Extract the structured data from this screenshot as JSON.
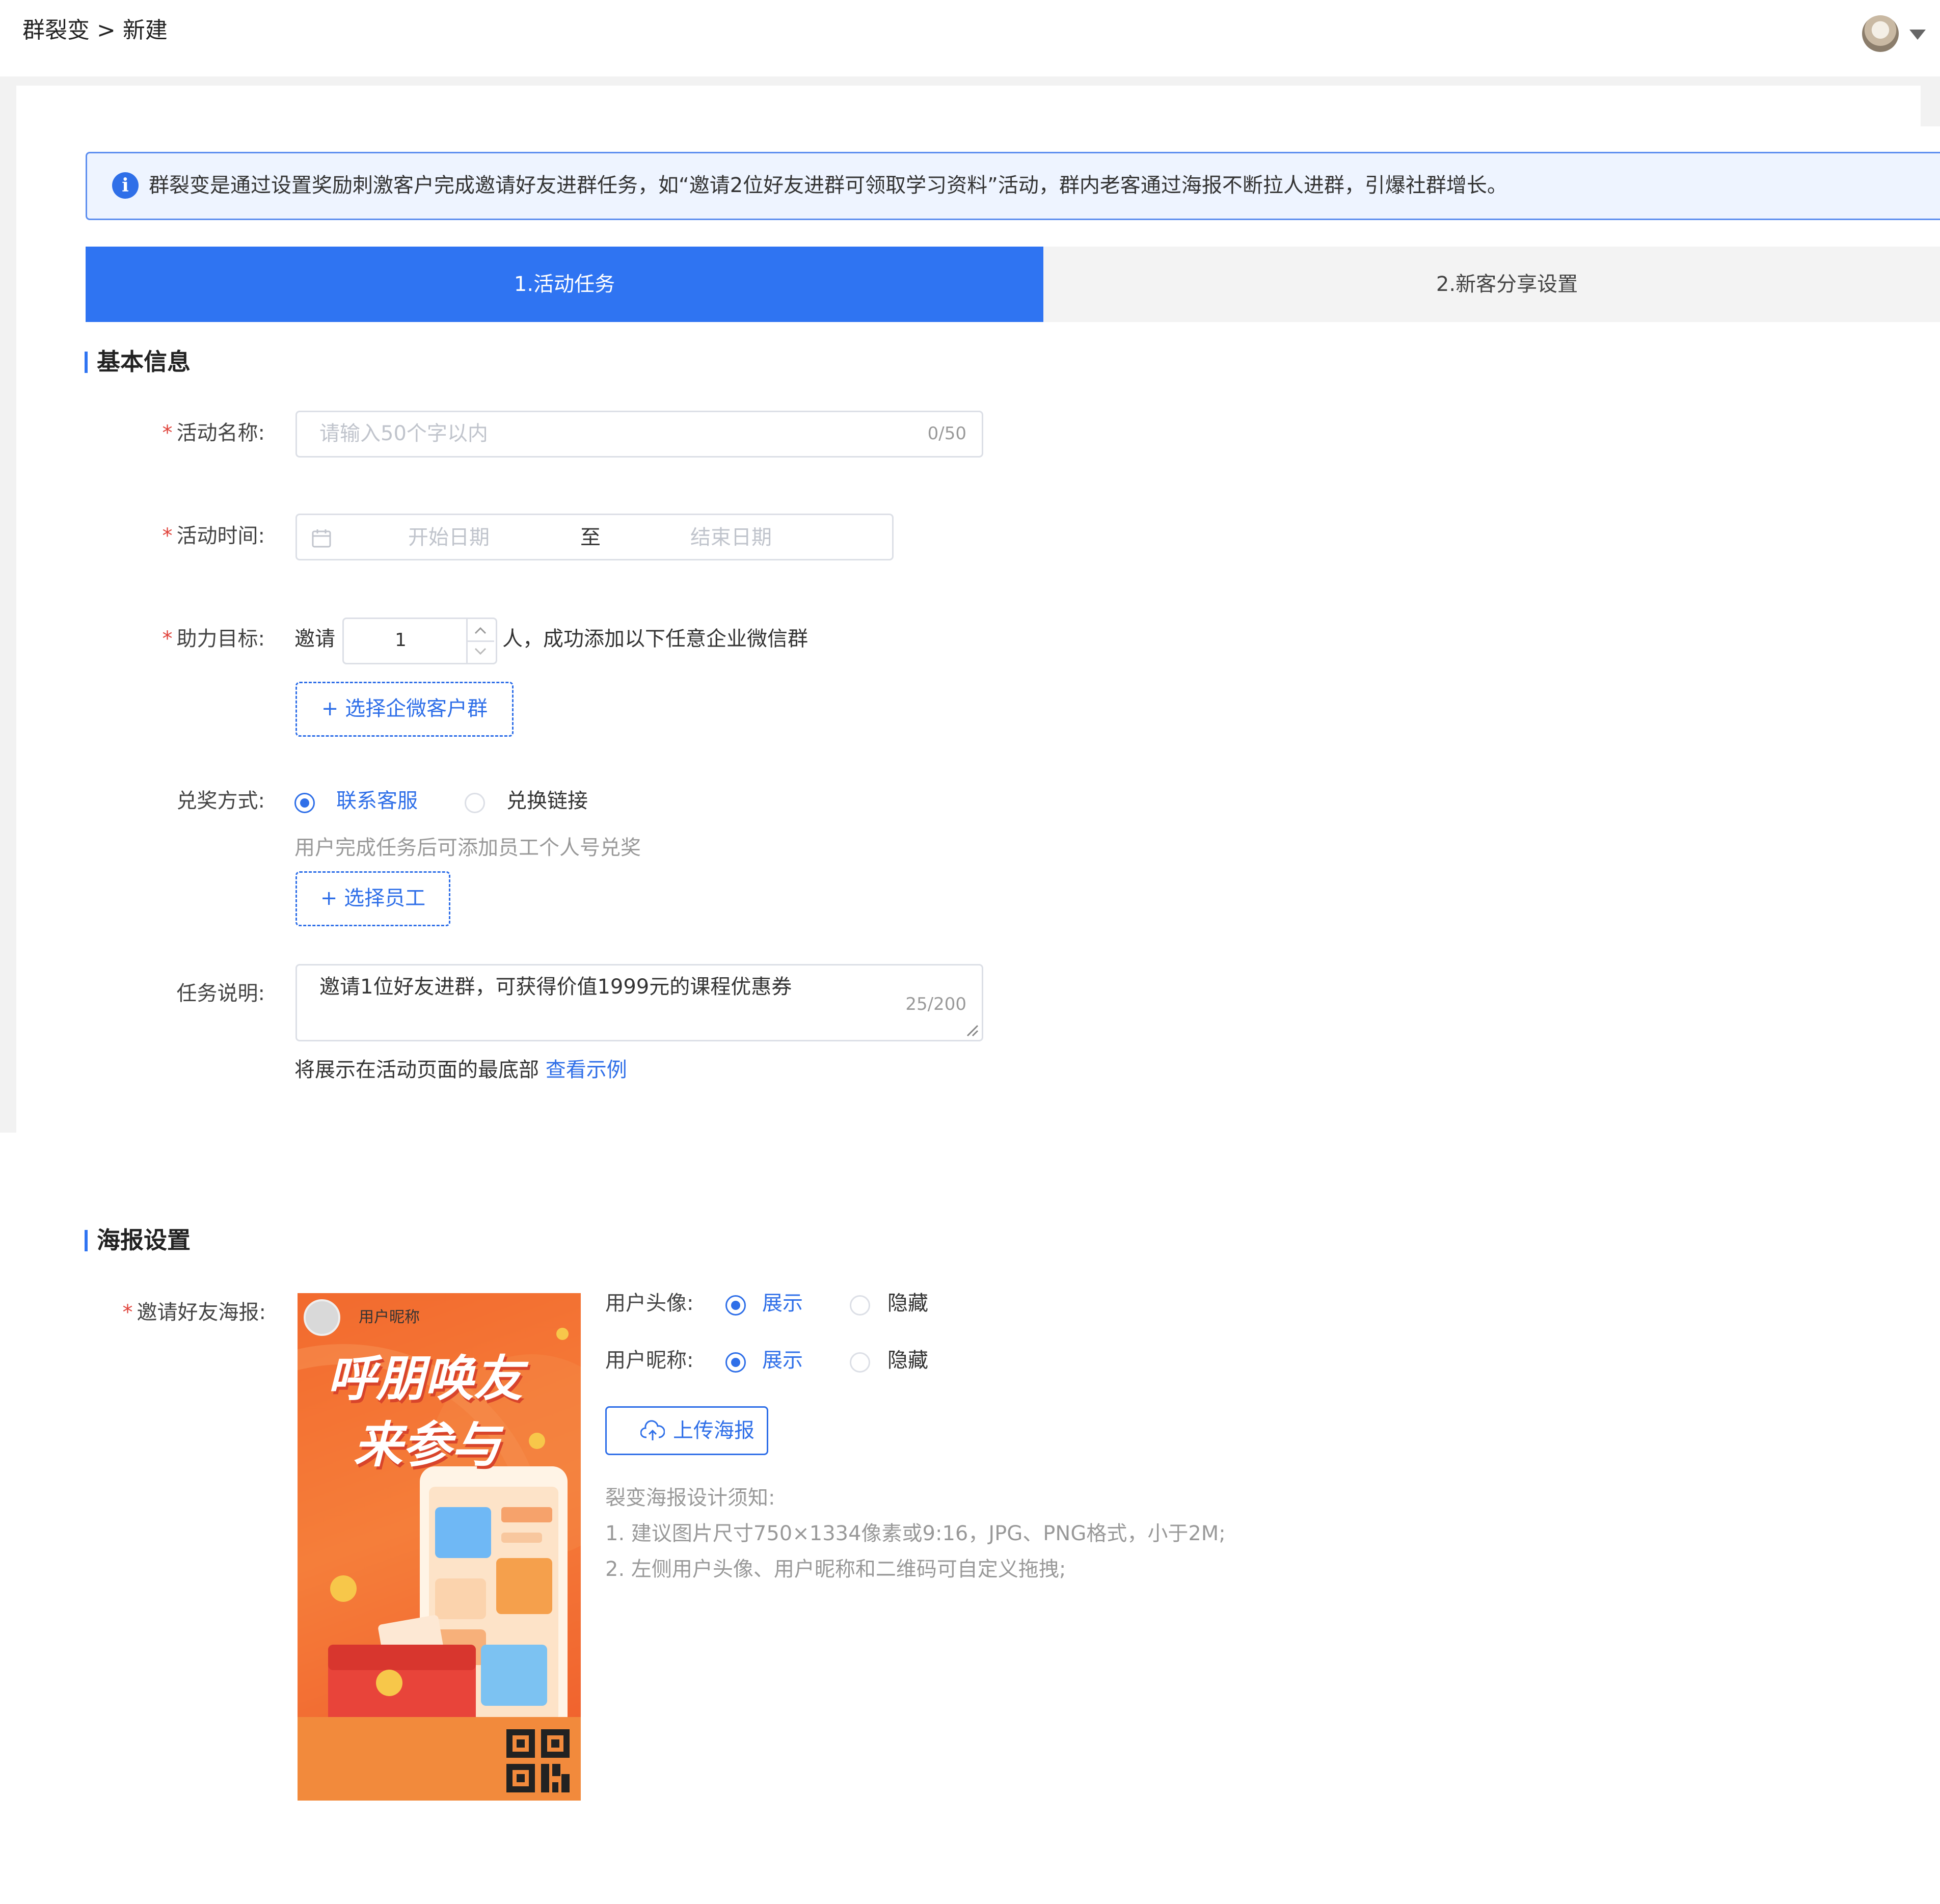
{
  "breadcrumb": {
    "text": "群裂变 > 新建"
  },
  "alert": {
    "text": "群裂变是通过设置奖励刺激客户完成邀请好友进群任务，如“邀请2位好友进群可领取学习资料”活动，群内老客通过海报不断拉人进群，引爆社群增长。"
  },
  "steps": [
    {
      "label": "1.活动任务",
      "active": true
    },
    {
      "label": "2.新客分享设置",
      "active": false
    }
  ],
  "basic": {
    "title": "基本信息",
    "name_label": "活动名称:",
    "name_placeholder": "请输入50个字以内",
    "name_counter": "0/50",
    "time_label": "活动时间:",
    "start_placeholder": "开始日期",
    "range_sep": "至",
    "end_placeholder": "结束日期",
    "goal_label": "助力目标:",
    "goal_prefix": "邀请",
    "goal_value": "1",
    "goal_suffix": "人，成功添加以下任意企业微信群",
    "select_group_button": "+ 选择企微客户群",
    "reward_label": "兑奖方式:",
    "reward_options": [
      "联系客服",
      "兑换链接"
    ],
    "reward_selected": "联系客服",
    "reward_hint": "用户完成任务后可添加员工个人号兑奖",
    "select_staff_button": "+ 选择员工",
    "desc_label": "任务说明:",
    "desc_value": "邀请1位好友进群，可获得价值1999元的课程优惠券",
    "desc_counter": "25/200",
    "desc_hint": "将展示在活动页面的最底部",
    "desc_link": "查看示例"
  },
  "poster": {
    "title": "海报设置",
    "invite_label": "邀请好友海报:",
    "nickname_text": "用户昵称",
    "headline_line1": "呼朋唤友",
    "headline_line2": "来参与",
    "avatar_label": "用户头像:",
    "nickname_label": "用户昵称:",
    "show_option": "展示",
    "hide_option": "隐藏",
    "avatar_selected": "展示",
    "nickname_selected": "展示",
    "upload_button": "上传海报",
    "notes_title": "裂变海报设计须知:",
    "note1": "1. 建议图片尺寸750×1334像素或9:16，JPG、PNG格式，小于2M;",
    "note2": "2. 左侧用户头像、用户昵称和二维码可自定义拖拽;"
  },
  "colors": {
    "primary": "#2f74f2",
    "required": "#e0443c",
    "poster_orange": "#f26a2e"
  },
  "icons": [
    "info-icon",
    "calendar-icon",
    "chevron-up-icon",
    "chevron-down-icon",
    "plus-icon",
    "cloud-upload-icon",
    "resize-handle-icon",
    "caret-down-icon"
  ]
}
